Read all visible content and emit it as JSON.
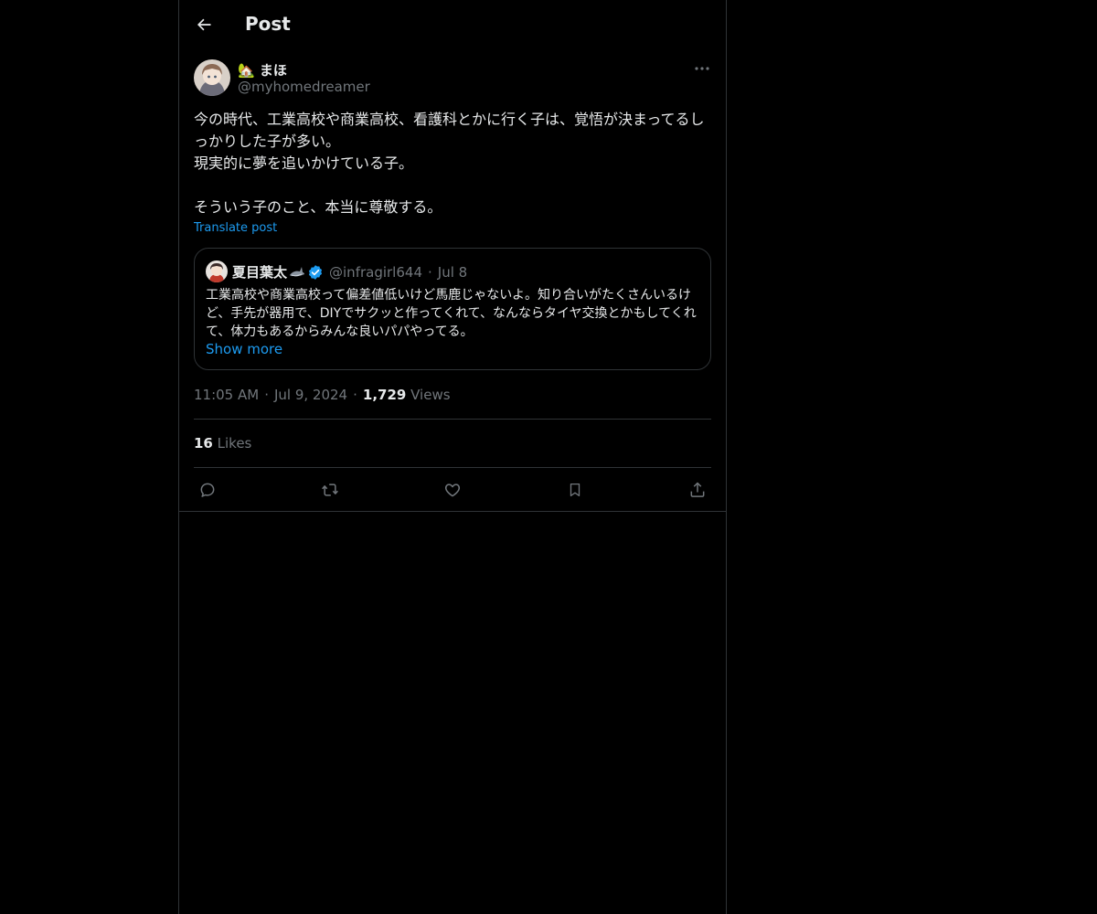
{
  "header": {
    "title": "Post",
    "back_icon": "arrow-left-icon"
  },
  "post": {
    "author": {
      "display_name": "🏡 まほ",
      "handle": "@myhomedreamer"
    },
    "text": "今の時代、工業高校や商業高校、看護科とかに行く子は、覚悟が決まってるしっかりした子が多い。\n現実的に夢を追いかけている子。\n\nそういう子のこと、本当に尊敬する。",
    "translate_label": "Translate post",
    "quote": {
      "display_name": "夏目葉太",
      "name_emoji": "shark-icon",
      "verified": true,
      "handle": "@infragirl644",
      "separator": "·",
      "date": "Jul 8",
      "text": "工業高校や商業高校って偏差値低いけど馬鹿じゃないよ。知り合いがたくさんいるけど、手先が器用で、DIYでサクッと作ってくれて、なんならタイヤ交換とかもしてくれて、体力もあるからみんな良いパパやってる。",
      "show_more": "Show more"
    },
    "meta": {
      "time": "11:05 AM",
      "separator": "·",
      "date": "Jul 9, 2024",
      "views_count": "1,729",
      "views_label": "Views"
    },
    "likes": {
      "count": "16",
      "label": "Likes"
    }
  },
  "actions": [
    "reply-icon",
    "repost-icon",
    "like-icon",
    "bookmark-icon",
    "share-icon"
  ],
  "colors": {
    "background": "#000000",
    "text": "#e7e9ea",
    "muted": "#71767b",
    "accent": "#1d9bf0",
    "border": "#2f3336"
  }
}
